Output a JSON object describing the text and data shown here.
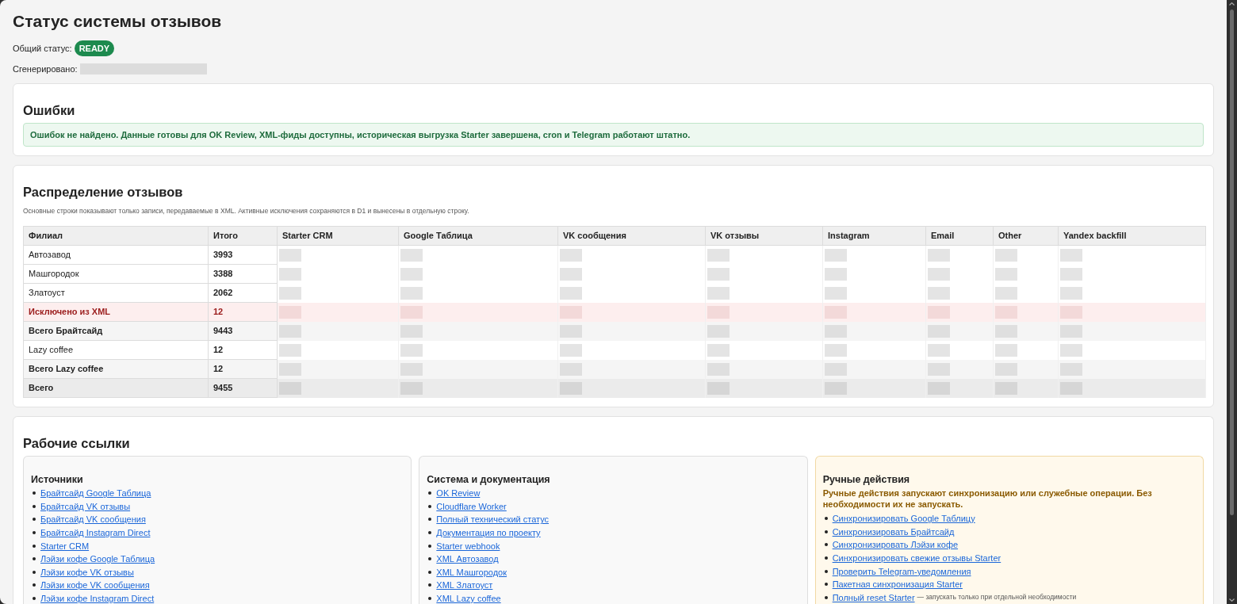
{
  "page": {
    "title": "Статус системы отзывов",
    "status_label": "Общий статус:",
    "status_badge": {
      "kind": "ready",
      "text": "READY"
    },
    "generated_label": "Сгенерировано:"
  },
  "errors": {
    "title": "Ошибки",
    "message": {
      "kind": "success",
      "text": "Ошибок не найдено. Данные готовы для OK Review, XML-фиды доступны, историческая выгрузка Starter завершена, cron и Telegram работают штатно."
    }
  },
  "distribution": {
    "title": "Распределение отзывов",
    "note": "Основные строки показывают только записи, передаваемые в XML. Активные исключения сохраняются в D1 и вынесены в отдельную строку.",
    "table": {
      "columns": [
        "Филиал",
        "Итого",
        "Starter CRM",
        "Google Таблица",
        "VK сообщения",
        "VK отзывы",
        "Instagram",
        "Email",
        "Other",
        "Yandex backfill"
      ],
      "rows": [
        {
          "kind": "branch",
          "branch": "Автозавод",
          "total": "3993"
        },
        {
          "kind": "branch",
          "branch": "Машгородок",
          "total": "3388"
        },
        {
          "kind": "branch",
          "branch": "Златоуст",
          "total": "2062"
        },
        {
          "kind": "excluded",
          "branch": "Исключено из XML",
          "total": "12"
        },
        {
          "kind": "subtotal",
          "branch": "Всего Брайтсайд",
          "total": "9443"
        },
        {
          "kind": "branch",
          "branch": "Lazy coffee",
          "total": "12"
        },
        {
          "kind": "subtotal",
          "branch": "Всего Lazy coffee",
          "total": "12"
        },
        {
          "kind": "total",
          "branch": "Всего",
          "total": "9455"
        }
      ]
    }
  },
  "links": {
    "title": "Рабочие ссылки",
    "panels": [
      {
        "kind": "neutral",
        "title": "Источники",
        "items": [
          {
            "text": "Брайтсайд Google Таблица"
          },
          {
            "text": "Брайтсайд VK отзывы"
          },
          {
            "text": "Брайтсайд VK сообщения"
          },
          {
            "text": "Брайтсайд Instagram Direct"
          },
          {
            "text": "Starter CRM"
          },
          {
            "text": "Лэйзи кофе Google Таблица"
          },
          {
            "text": "Лэйзи кофе VK отзывы"
          },
          {
            "text": "Лэйзи кофе VK сообщения"
          },
          {
            "text": "Лэйзи кофе Instagram Direct"
          }
        ]
      },
      {
        "kind": "neutral",
        "title": "Система и документация",
        "items": [
          {
            "text": "OK Review"
          },
          {
            "text": "Cloudflare Worker"
          },
          {
            "text": "Полный технический статус"
          },
          {
            "text": "Документация по проекту"
          },
          {
            "text": "Starter webhook"
          },
          {
            "text": "XML Автозавод"
          },
          {
            "text": "XML Машгородок"
          },
          {
            "text": "XML Златоуст"
          },
          {
            "text": "XML Lazy coffee"
          }
        ]
      },
      {
        "kind": "warning",
        "title": "Ручные действия",
        "warning": "Ручные действия запускают синхронизацию или служебные операции. Без необходимости их не запускать.",
        "items": [
          {
            "text": "Синхронизировать Google Таблицу"
          },
          {
            "text": "Синхронизировать Брайтсайд"
          },
          {
            "text": "Синхронизировать Лэйзи кофе"
          },
          {
            "text": "Синхронизировать свежие отзывы Starter"
          },
          {
            "text": "Проверить Telegram-уведомления"
          },
          {
            "text": "Пакетная синхронизация Starter"
          },
          {
            "text": "Полный reset Starter",
            "note": "— запускать только при отдельной необходимости"
          }
        ]
      }
    ]
  }
}
